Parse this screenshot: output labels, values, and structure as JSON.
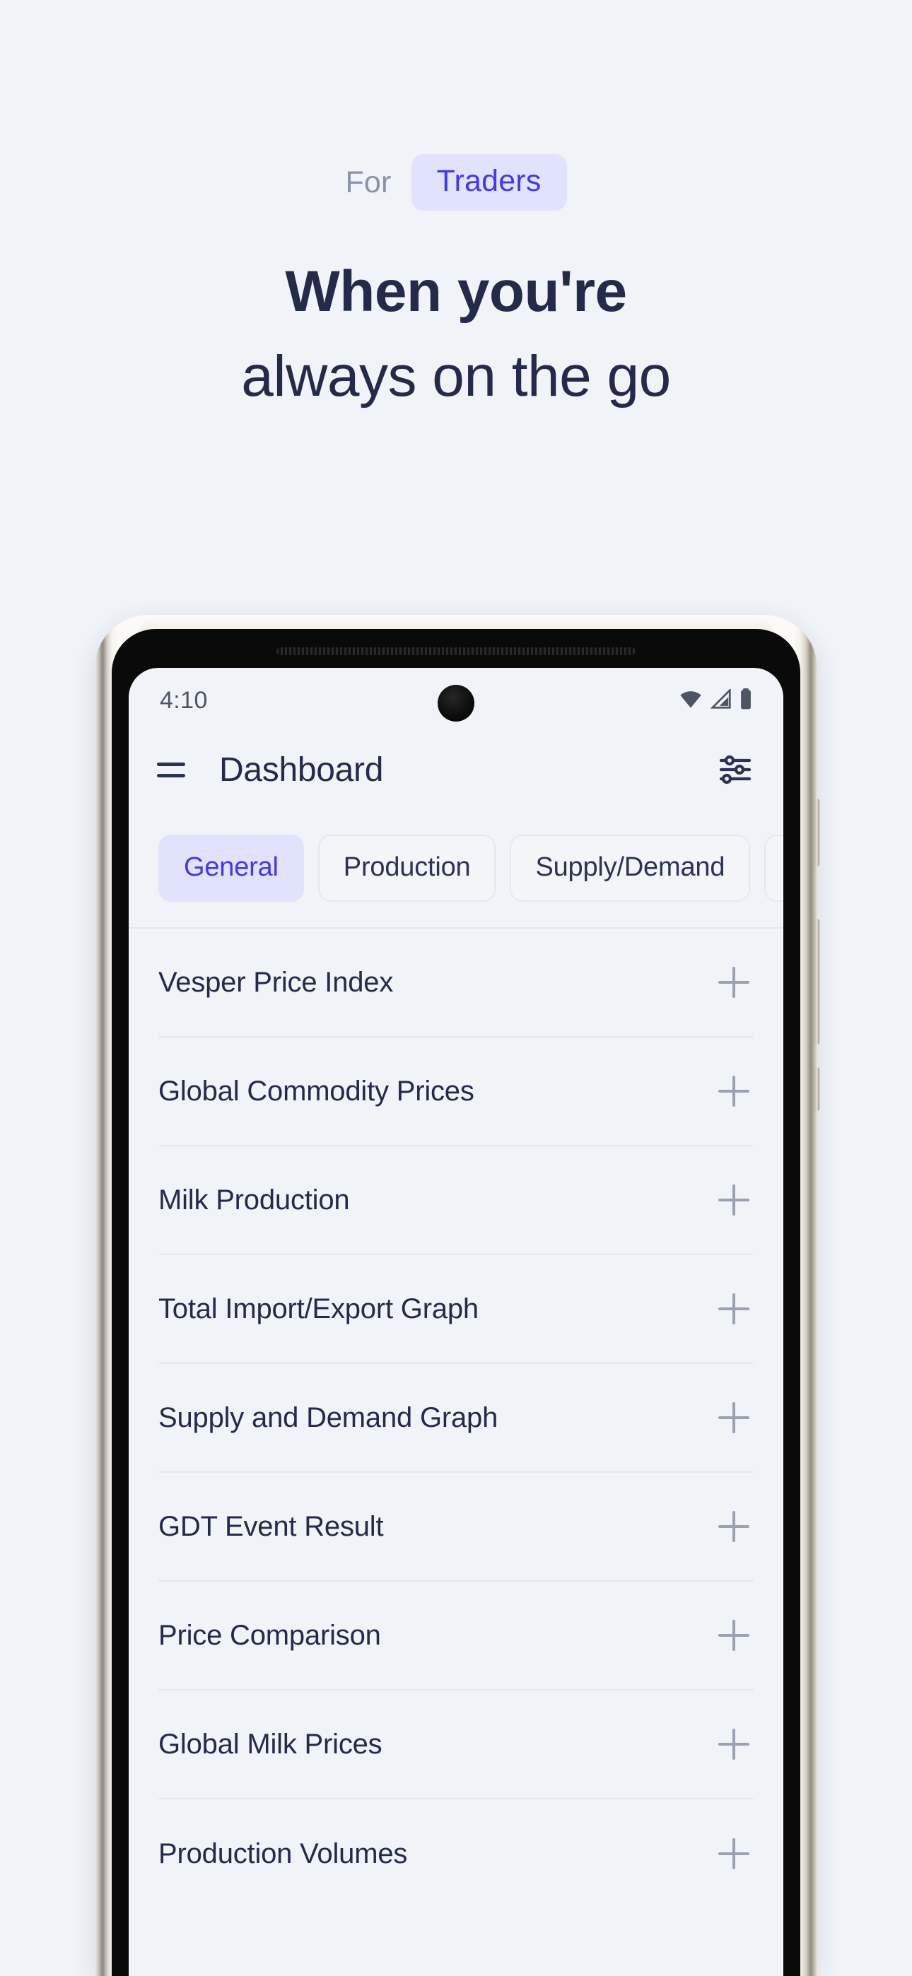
{
  "hero": {
    "eyebrow_prefix": "For",
    "eyebrow_pill": "Traders",
    "headline_line1": "When you're",
    "headline_line2": "always on the go",
    "colors": {
      "page_background": "#f0f3f8",
      "headline": "#242a49",
      "eyebrow_prefix": "#8b93a7",
      "accent": "#4338ec",
      "accent_soft": "#e0e3fb"
    }
  },
  "phone": {
    "status_bar": {
      "time": "4:10",
      "icons": [
        "wifi-icon",
        "cell-signal-icon",
        "battery-icon"
      ]
    },
    "app_bar": {
      "menu_icon": "hamburger-menu-icon",
      "title": "Dashboard",
      "action_icon": "tune-sliders-icon"
    },
    "tabs": [
      {
        "label": "General",
        "active": true
      },
      {
        "label": "Production",
        "active": false
      },
      {
        "label": "Supply/Demand",
        "active": false
      },
      {
        "label": "",
        "active": false
      }
    ],
    "list": {
      "expand_icon": "plus-icon",
      "items": [
        {
          "label": "Vesper Price Index"
        },
        {
          "label": "Global Commodity Prices"
        },
        {
          "label": "Milk Production"
        },
        {
          "label": "Total Import/Export Graph"
        },
        {
          "label": "Supply and Demand Graph"
        },
        {
          "label": "GDT Event Result"
        },
        {
          "label": "Price Comparison"
        },
        {
          "label": "Global Milk Prices"
        },
        {
          "label": "Production Volumes"
        }
      ]
    }
  }
}
